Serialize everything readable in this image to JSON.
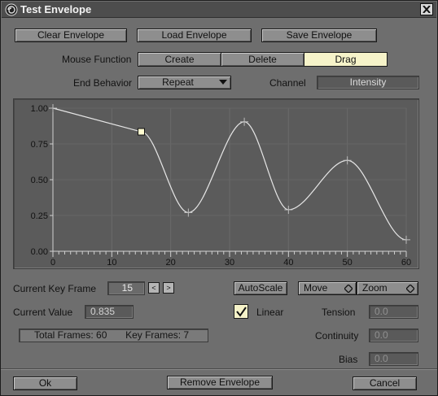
{
  "window": {
    "title": "Test Envelope"
  },
  "toolbar": {
    "clear_label": "Clear Envelope",
    "load_label": "Load Envelope",
    "save_label": "Save Envelope"
  },
  "mouse_function": {
    "label": "Mouse Function",
    "options": [
      "Create",
      "Delete",
      "Drag"
    ],
    "selected": "Drag"
  },
  "end_behavior": {
    "label": "End Behavior",
    "value": "Repeat"
  },
  "channel": {
    "label": "Channel",
    "value": "Intensity"
  },
  "graph": {
    "y_ticks": [
      "1.00",
      "0.75",
      "0.50",
      "0.25",
      "0.00"
    ],
    "x_ticks": [
      "0",
      "10",
      "20",
      "30",
      "40",
      "50",
      "60"
    ]
  },
  "chart_data": {
    "type": "line",
    "x_range": [
      0,
      60
    ],
    "y_range": [
      0,
      1
    ],
    "keys": [
      {
        "frame": 0,
        "value": 1.0
      },
      {
        "frame": 15,
        "value": 0.835
      },
      {
        "frame": 23,
        "value": 0.27
      },
      {
        "frame": 32.5,
        "value": 0.905
      },
      {
        "frame": 40,
        "value": 0.29
      },
      {
        "frame": 50,
        "value": 0.635
      },
      {
        "frame": 60,
        "value": 0.08
      }
    ],
    "selected_key_frame": 15,
    "grid": true
  },
  "key_frame": {
    "label": "Current Key Frame",
    "value": "15",
    "prev_label": "<",
    "next_label": ">"
  },
  "current_value": {
    "label": "Current Value",
    "value": "0.835"
  },
  "controls": {
    "autoscale_label": "AutoScale",
    "move_label": "Move",
    "zoom_label": "Zoom",
    "linear_label": "Linear",
    "linear_checked": true
  },
  "status": {
    "total_frames": "Total Frames: 60",
    "key_frames": "Key Frames: 7"
  },
  "params": {
    "tension_label": "Tension",
    "tension_value": "0.0",
    "continuity_label": "Continuity",
    "continuity_value": "0.0",
    "bias_label": "Bias",
    "bias_value": "0.0"
  },
  "footer": {
    "ok_label": "Ok",
    "remove_label": "Remove Envelope",
    "cancel_label": "Cancel"
  },
  "colors": {
    "selected_segment": "#f6f3c9",
    "curve": "#e6e6e6",
    "key_marker": "#fffbd0"
  }
}
